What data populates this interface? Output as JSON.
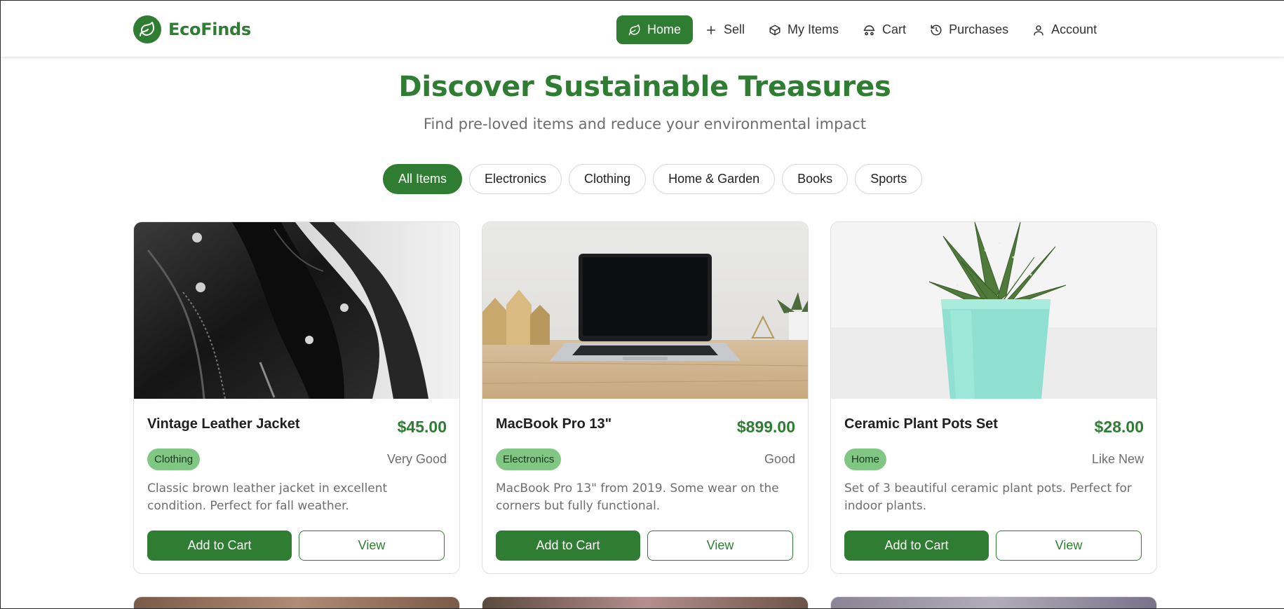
{
  "brand": {
    "name": "EcoFinds",
    "icon": "leaf-icon",
    "accent": "#2e7d32"
  },
  "nav": [
    {
      "label": "Home",
      "icon": "leaf-icon",
      "active": true
    },
    {
      "label": "Sell",
      "icon": "plus-icon",
      "active": false
    },
    {
      "label": "My Items",
      "icon": "box-icon",
      "active": false
    },
    {
      "label": "Cart",
      "icon": "cart-icon",
      "active": false
    },
    {
      "label": "Purchases",
      "icon": "history-icon",
      "active": false
    },
    {
      "label": "Account",
      "icon": "user-icon",
      "active": false
    }
  ],
  "hero": {
    "title": "Discover Sustainable Treasures",
    "subtitle": "Find pre-loved items and reduce your environmental impact"
  },
  "filters": {
    "items": [
      "All Items",
      "Electronics",
      "Clothing",
      "Home & Garden",
      "Books",
      "Sports"
    ],
    "selected": "All Items"
  },
  "products": [
    {
      "name": "Vintage Leather Jacket",
      "price": "$45.00",
      "category": "Clothing",
      "condition": "Very Good",
      "description": "Classic brown leather jacket in excellent condition. Perfect for fall weather.",
      "add_label": "Add to Cart",
      "view_label": "View"
    },
    {
      "name": "MacBook Pro 13\"",
      "price": "$899.00",
      "category": "Electronics",
      "condition": "Good",
      "description": "MacBook Pro 13\" from 2019. Some wear on the corners but fully functional.",
      "add_label": "Add to Cart",
      "view_label": "View"
    },
    {
      "name": "Ceramic Plant Pots Set",
      "price": "$28.00",
      "category": "Home",
      "condition": "Like New",
      "description": "Set of 3 beautiful ceramic plant pots. Perfect for indoor plants.",
      "add_label": "Add to Cart",
      "view_label": "View"
    }
  ],
  "colors": {
    "primary": "#2e7d32",
    "badge": "#81c784",
    "muted_text": "#6e6e6e"
  }
}
